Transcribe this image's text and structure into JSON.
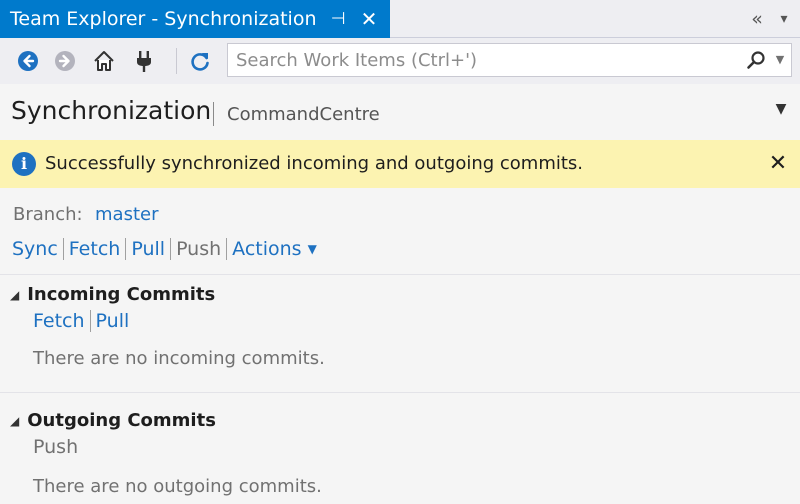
{
  "tab": {
    "title": "Team Explorer - Synchronization",
    "pin_glyph": "⊣",
    "close_glyph": "✕",
    "overflow_glyph": "«",
    "dropdown_glyph": "▾"
  },
  "toolbar": {
    "buttons": [
      "back-icon",
      "forward-icon",
      "home-icon",
      "connect-icon",
      "refresh-icon"
    ],
    "search_placeholder": "Search Work Items (Ctrl+')"
  },
  "header": {
    "title": "Synchronization",
    "subtitle": "CommandCentre"
  },
  "infobar": {
    "icon": "i",
    "message": "Successfully synchronized incoming and outgoing commits.",
    "close": "✕"
  },
  "branch": {
    "label": "Branch:",
    "value": "master"
  },
  "actions": {
    "sync": "Sync",
    "fetch": "Fetch",
    "pull": "Pull",
    "push": "Push",
    "actions": "Actions"
  },
  "incoming": {
    "title": "Incoming Commits",
    "fetch": "Fetch",
    "pull": "Pull",
    "empty": "There are no incoming commits."
  },
  "outgoing": {
    "title": "Outgoing Commits",
    "push": "Push",
    "empty": "There are no outgoing commits."
  },
  "colors": {
    "accent": "#007acc",
    "link": "#1e71c1",
    "infobar": "#fcf3b1"
  }
}
